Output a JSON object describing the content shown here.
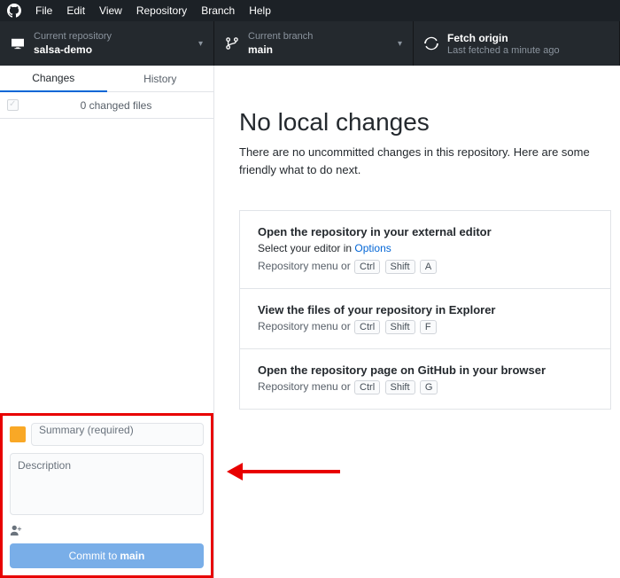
{
  "menubar": {
    "items": [
      "File",
      "Edit",
      "View",
      "Repository",
      "Branch",
      "Help"
    ]
  },
  "toolbar": {
    "repo": {
      "label": "Current repository",
      "value": "salsa-demo"
    },
    "branch": {
      "label": "Current branch",
      "value": "main"
    },
    "fetch": {
      "title": "Fetch origin",
      "subtitle": "Last fetched a minute ago"
    }
  },
  "tabs": {
    "changes": "Changes",
    "history": "History"
  },
  "fileshdr": "0 changed files",
  "commit": {
    "summary_placeholder": "Summary (required)",
    "desc_placeholder": "Description",
    "button_prefix": "Commit to ",
    "button_branch": "main"
  },
  "main": {
    "heading": "No local changes",
    "sub": "There are no uncommitted changes in this repository. Here are some friendly what to do next.",
    "cards": [
      {
        "title": "Open the repository in your external editor",
        "sub": "Select your editor in ",
        "link": "Options",
        "shortcut_prefix": "Repository menu or ",
        "keys": [
          "Ctrl",
          "Shift",
          "A"
        ]
      },
      {
        "title": "View the files of your repository in Explorer",
        "sub": "",
        "link": "",
        "shortcut_prefix": "Repository menu or ",
        "keys": [
          "Ctrl",
          "Shift",
          "F"
        ]
      },
      {
        "title": "Open the repository page on GitHub in your browser",
        "sub": "",
        "link": "",
        "shortcut_prefix": "Repository menu or ",
        "keys": [
          "Ctrl",
          "Shift",
          "G"
        ]
      }
    ]
  }
}
